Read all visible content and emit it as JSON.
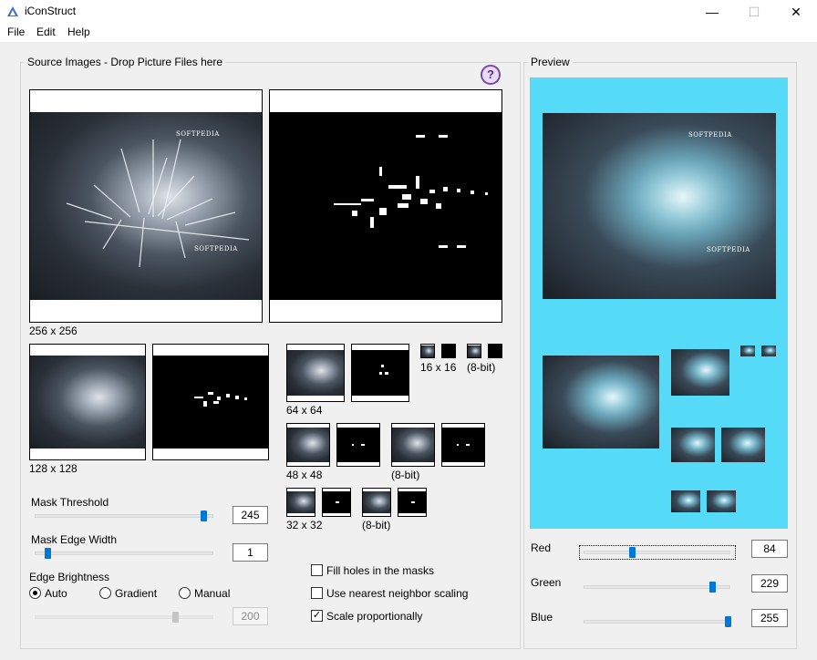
{
  "window": {
    "title": "iConStruct",
    "minimize": "—",
    "maximize": "☐",
    "close": "✕"
  },
  "menu": {
    "file": "File",
    "edit": "Edit",
    "help": "Help"
  },
  "source": {
    "group_label": "Source Images - Drop Picture Files here",
    "help_glyph": "?",
    "watermark_text": "SOFTPEDIA",
    "sizes": {
      "s256": "256 x 256",
      "s128": "128 x 128",
      "s64": "64 x 64",
      "s48": "48 x 48",
      "s48_8bit": "(8-bit)",
      "s32": "32 x 32",
      "s32_8bit": "(8-bit)",
      "s16": "16 x 16",
      "s16_8bit": "(8-bit)"
    }
  },
  "controls": {
    "mask_threshold": {
      "label": "Mask Threshold",
      "value": "245",
      "fraction": 0.96
    },
    "mask_edge_width": {
      "label": "Mask Edge Width",
      "value": "1",
      "fraction": 0.04
    },
    "edge_brightness": {
      "label": "Edge Brightness",
      "options": [
        "Auto",
        "Gradient",
        "Manual"
      ],
      "selected": "Auto",
      "value": "200",
      "fraction": 0.78
    },
    "checkboxes": [
      {
        "label": "Fill holes in the masks",
        "checked": false
      },
      {
        "label": "Use nearest neighbor scaling",
        "checked": false
      },
      {
        "label": "Scale proportionally",
        "checked": true
      }
    ]
  },
  "preview": {
    "group_label": "Preview",
    "background_color": "#55dbf7",
    "red": {
      "label": "Red",
      "value": "84",
      "fraction": 0.33
    },
    "green": {
      "label": "Green",
      "value": "229",
      "fraction": 0.9
    },
    "blue": {
      "label": "Blue",
      "value": "255",
      "fraction": 1.0
    }
  },
  "colors": {
    "accent": "#0078d7",
    "preview_cyan": "#55dbf7"
  }
}
